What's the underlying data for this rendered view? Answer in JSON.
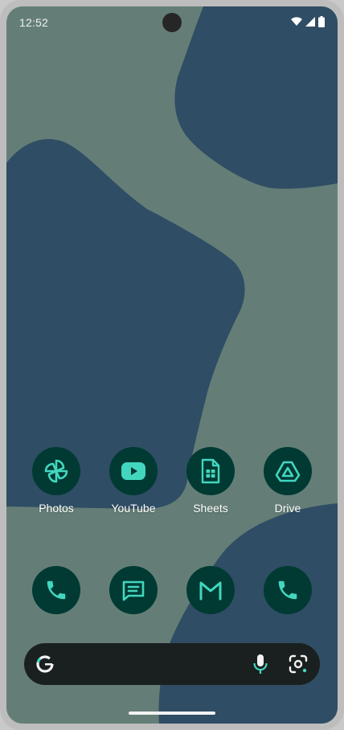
{
  "status_bar": {
    "time": "12:52",
    "icons": [
      "wifi-icon",
      "signal-icon",
      "battery-icon"
    ]
  },
  "home_apps": [
    {
      "label": "Photos",
      "icon": "pinwheel-icon"
    },
    {
      "label": "YouTube",
      "icon": "play-button-icon"
    },
    {
      "label": "Sheets",
      "icon": "spreadsheet-icon"
    },
    {
      "label": "Drive",
      "icon": "triangle-drive-icon"
    }
  ],
  "dock": [
    {
      "icon": "phone-icon"
    },
    {
      "icon": "message-icon"
    },
    {
      "icon": "gmail-icon"
    },
    {
      "icon": "phone-icon"
    }
  ],
  "search_bar": {
    "icons": [
      "google-g-icon",
      "mic-icon",
      "lens-icon"
    ]
  },
  "colors": {
    "wallpaper_base": "#647e77",
    "wallpaper_shapes": "#2f4d64",
    "icon_background": "#003a33",
    "icon_foreground": "#43d6bf",
    "search_background": "#1a201f"
  }
}
